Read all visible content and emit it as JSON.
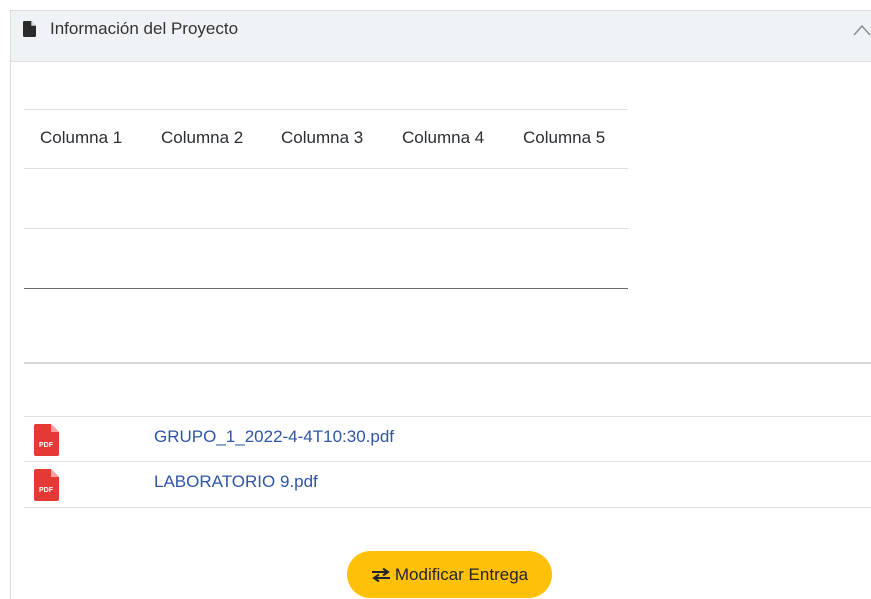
{
  "card": {
    "title": "Información del Proyecto",
    "header_icon": "document-icon",
    "collapse_icon": "chevron-up-icon"
  },
  "table": {
    "columns": [
      "Columna 1",
      "Columna 2",
      "Columna 3",
      "Columna 4",
      "Columna 5"
    ],
    "rows": [
      [
        "",
        "",
        "",
        "",
        ""
      ],
      [
        "",
        "",
        "",
        "",
        ""
      ]
    ]
  },
  "files": [
    {
      "name": "GRUPO_1_2022-4-4T10:30.pdf",
      "icon": "pdf-icon",
      "icon_label": "PDF"
    },
    {
      "name": "LABORATORIO 9.pdf",
      "icon": "pdf-icon",
      "icon_label": "PDF"
    }
  ],
  "actions": {
    "modify_label": "Modificar Entrega",
    "modify_icon": "swap-arrows-icon",
    "modify_color": "#ffc107"
  },
  "colors": {
    "header_bg": "#f0f3f6",
    "link": "#2f55a4",
    "pdf_red": "#e53935"
  }
}
